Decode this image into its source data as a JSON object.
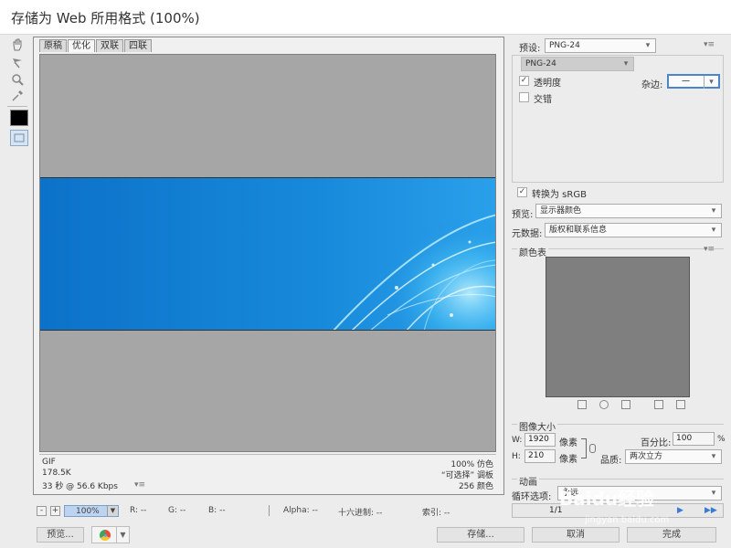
{
  "window": {
    "title": "存储为 Web 所用格式 (100%)"
  },
  "tools": [
    {
      "name": "hand-icon",
      "glyph": "✋"
    },
    {
      "name": "slice-select-icon",
      "glyph": "↖"
    },
    {
      "name": "zoom-icon",
      "glyph": "🔍"
    },
    {
      "name": "eyedropper-icon",
      "glyph": "✎"
    }
  ],
  "swatches": {
    "eyedropper_color": "#000000"
  },
  "tabs": [
    {
      "label": "原稿"
    },
    {
      "label": "优化"
    },
    {
      "label": "双联"
    },
    {
      "label": "四联"
    }
  ],
  "image_info": {
    "format": "GIF",
    "size": "178.5K",
    "time": "33 秒 @ 56.6 Kbps",
    "dither": "100% 仿色",
    "palette": "“可选择” 调板",
    "colors": "256 颜色"
  },
  "statusbar": {
    "zoom": "100%",
    "r": "R: --",
    "g": "G: --",
    "b": "B: --",
    "alpha": "Alpha: --",
    "hex": "十六进制: --",
    "index": "索引: --"
  },
  "bottom_buttons": {
    "preview": "预览...",
    "save": "存储...",
    "cancel": "取消",
    "done": "完成"
  },
  "settings": {
    "preset_label": "预设:",
    "preset_value": "PNG-24",
    "format_value": "PNG-24",
    "transparency_label": "透明度",
    "transparency_checked": true,
    "interlaced_label": "交错",
    "interlaced_checked": false,
    "matte_label": "杂边:",
    "matte_value": "一",
    "convert_srgb_label": "转换为 sRGB",
    "convert_srgb_checked": true,
    "preview_label": "预览:",
    "preview_value": "显示器颜色",
    "metadata_label": "元数据:",
    "metadata_value": "版权和联系信息"
  },
  "color_table": {
    "title": "颜色表",
    "background_color": "#7f7f7f"
  },
  "image_size": {
    "title": "图像大小",
    "w_label": "W:",
    "w_value": "1920",
    "h_label": "H:",
    "h_value": "210",
    "px_label": "像素",
    "percent_label": "百分比:",
    "percent_value": "100",
    "percent_unit": "%",
    "quality_label": "品质:",
    "quality_value": "两次立方"
  },
  "animation": {
    "title": "动画",
    "loop_label": "循环选项:",
    "loop_value": "永远",
    "frame": "1/1"
  },
  "watermark": {
    "brand": "Baidu经验",
    "url": "jingyan.baidu.com"
  },
  "colors": {
    "accent": "#1788d8",
    "canvas_bg": "#a6a6a6"
  }
}
